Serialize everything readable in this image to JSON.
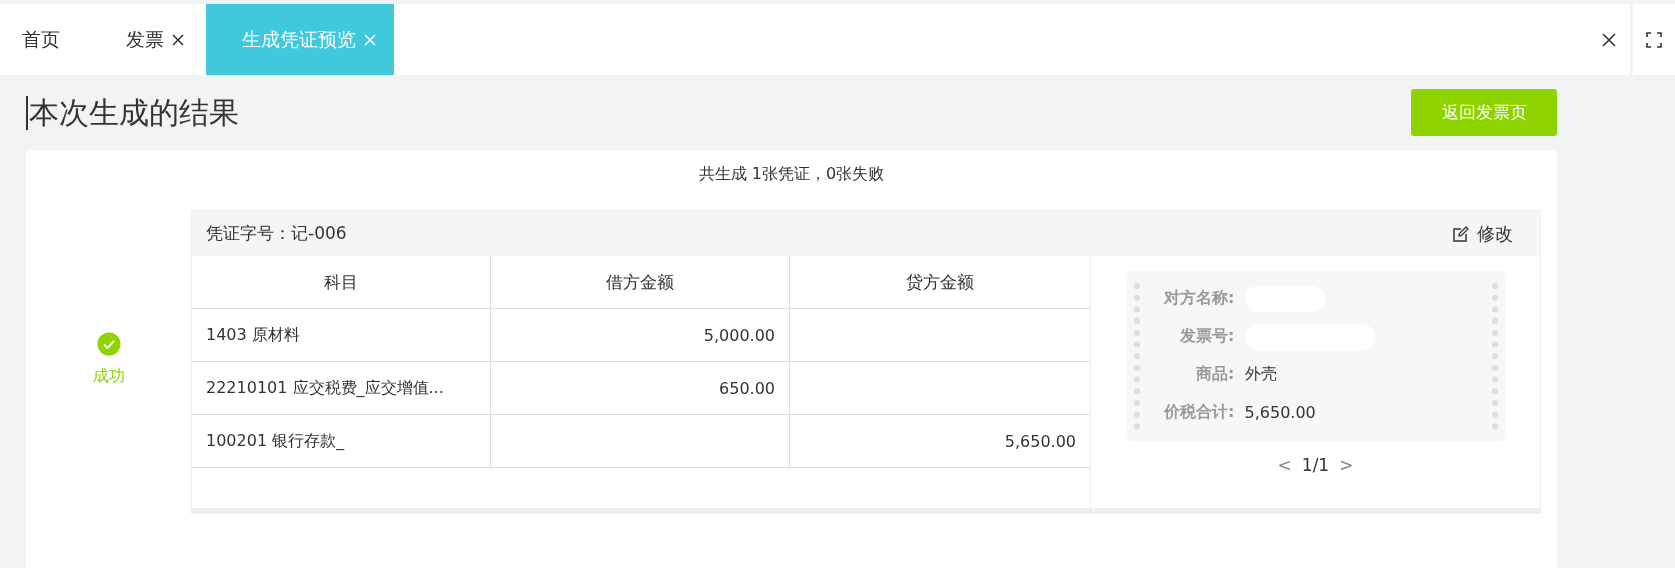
{
  "tabs": [
    {
      "label": "首页",
      "selected": false,
      "closable": false
    },
    {
      "label": "发票",
      "selected": false,
      "closable": true
    },
    {
      "label": "生成凭证预览",
      "selected": true,
      "closable": true
    }
  ],
  "window_controls": [
    {
      "kind": "close"
    },
    {
      "kind": "fullscreen"
    }
  ],
  "page": {
    "title": "本次生成的结果",
    "back_button": "返回发票页"
  },
  "summary": "共生成 1张凭证，0张失败",
  "result": {
    "kind": "success",
    "label": "成功"
  },
  "voucher": {
    "number": "凭证字号：记-006",
    "edit": "修改",
    "columns": [
      "科目",
      "借方金额",
      "贷方金额"
    ],
    "rows": [
      [
        "1403 原材料",
        "5,000.00",
        ""
      ],
      [
        "22210101 应交税费_应交增值...",
        "650.00",
        ""
      ],
      [
        "100201 银行存款_",
        "",
        "5,650.00"
      ]
    ],
    "invoice": {
      "fields": [
        {
          "label": "对方名称:",
          "redacted": true
        },
        {
          "label": "发票号:",
          "redacted": true
        },
        {
          "label": "商品:",
          "value": "外壳",
          "redacted": false
        },
        {
          "label": "价税合计:",
          "value": "5,650.00",
          "redacted": false
        }
      ],
      "pager": {
        "prev": "<",
        "page": "1/1",
        "next": ">"
      }
    }
  }
}
